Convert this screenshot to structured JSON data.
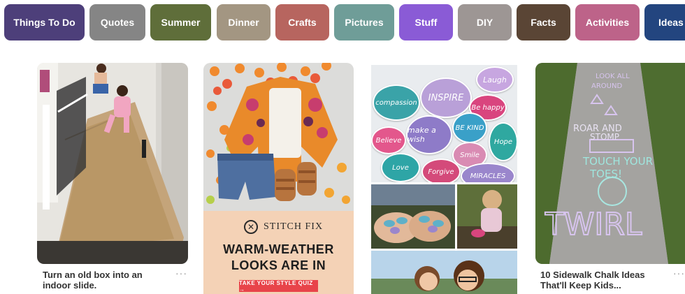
{
  "topics": [
    {
      "label": "Things To Do",
      "color": "#4d3f7a"
    },
    {
      "label": "Quotes",
      "color": "#858585"
    },
    {
      "label": "Summer",
      "color": "#5f6e3a"
    },
    {
      "label": "Dinner",
      "color": "#a39682"
    },
    {
      "label": "Crafts",
      "color": "#b7655f"
    },
    {
      "label": "Pictures",
      "color": "#6f9d98"
    },
    {
      "label": "Stuff",
      "color": "#8a5bd6"
    },
    {
      "label": "DIY",
      "color": "#9d9694"
    },
    {
      "label": "Facts",
      "color": "#5a4535"
    },
    {
      "label": "Activities",
      "color": "#bd6389"
    },
    {
      "label": "Ideas",
      "color": "#23457f"
    }
  ],
  "pins": [
    {
      "caption": "Turn an old box into an indoor slide.",
      "more": "···"
    },
    {
      "ad_brand": "STITCH FIX",
      "ad_headline_1": "WARM-WEATHER",
      "ad_headline_2": "LOOKS ARE IN",
      "ad_cta": "TAKE YOUR STYLE QUIZ →"
    },
    {
      "stones": [
        "Laugh",
        "INSPIRE",
        "compassion",
        "Be happy",
        "Believe",
        "make a wish",
        "BE KIND",
        "Hope",
        "Love",
        "Smile",
        "Forgive",
        "MIRACLES"
      ]
    },
    {
      "chalk": [
        "ROAR AND STOMP",
        "TOUCH YOUR TOES!",
        "TWIRL"
      ],
      "caption": "10 Sidewalk Chalk Ideas That'll Keep Kids...",
      "more": "···"
    }
  ]
}
